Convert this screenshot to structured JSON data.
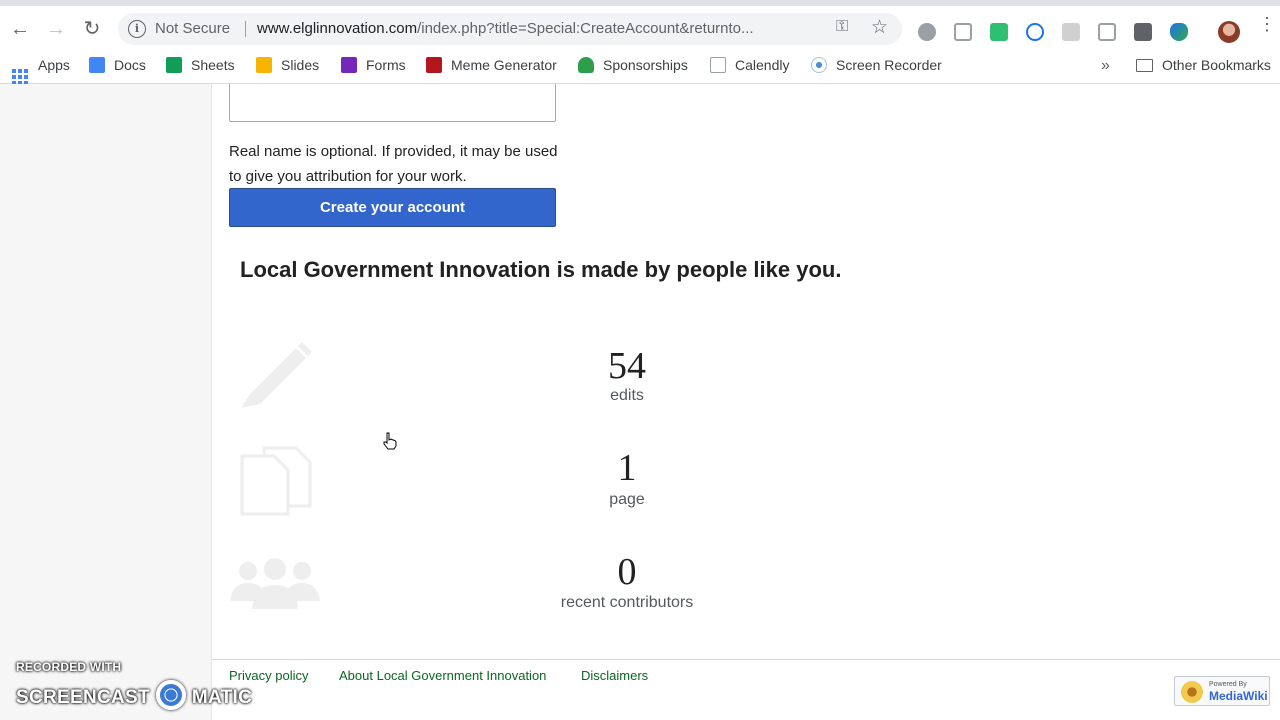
{
  "browser": {
    "security_label": "Not Secure",
    "url_host": "www.elglinnovation.com",
    "url_rest": "/index.php?title=Special:CreateAccount&returnto...",
    "bookmarks": [
      "Docs",
      "Sheets",
      "Slides",
      "Forms",
      "Meme Generator",
      "Sponsorships",
      "Calendly",
      "Screen Recorder"
    ],
    "apps_label": "Apps",
    "overflow_icon": "chevron-double-right-icon",
    "other_bookmarks": "Other Bookmarks"
  },
  "form": {
    "realname_value": "",
    "realname_help": "Real name is optional. If provided, it may be used to give you attribution for your work.",
    "submit_label": "Create your account"
  },
  "promo": {
    "heading": "Local Government Innovation is made by people like you.",
    "stats": [
      {
        "number": "54",
        "label": "edits",
        "icon": "pencil-icon"
      },
      {
        "number": "1",
        "label": "page",
        "icon": "pages-icon"
      },
      {
        "number": "0",
        "label": "recent contributors",
        "icon": "people-icon"
      }
    ]
  },
  "footer": {
    "links": [
      "Privacy policy",
      "About Local Government Innovation",
      "Disclaimers"
    ],
    "badge_small": "Powered By",
    "badge_big": "MediaWiki"
  },
  "watermark": {
    "top": "RECORDED WITH",
    "left": "SCREENCAST",
    "right": "MATIC"
  },
  "colors": {
    "primary_button": "#3366cc",
    "footer_link": "#0b6623",
    "sidebar_bg": "#f6f6f6"
  }
}
